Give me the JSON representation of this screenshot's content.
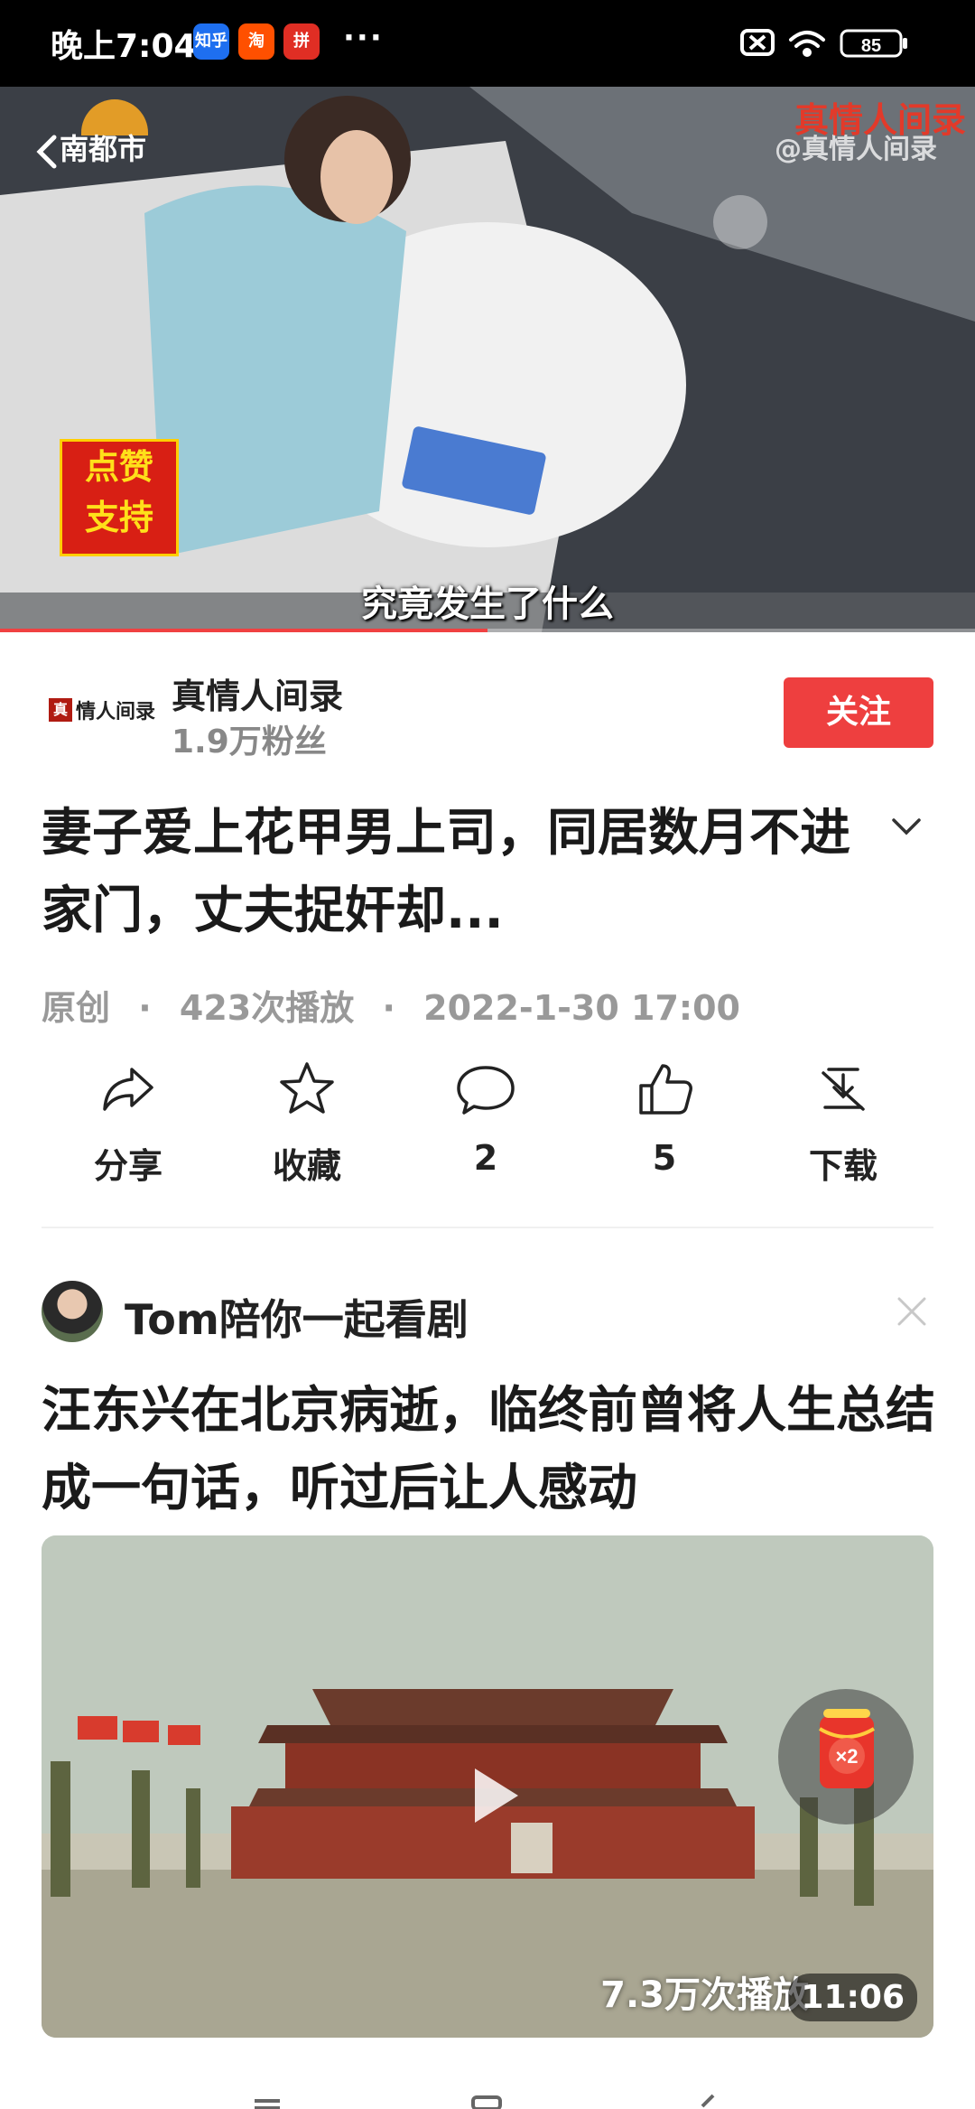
{
  "status_bar": {
    "time": "晚上7:04",
    "apps": [
      {
        "name": "zhihu-icon",
        "label": "知乎",
        "color": "#1e6ff0"
      },
      {
        "name": "taobao-icon",
        "label": "淘",
        "color": "#ff5000"
      },
      {
        "name": "pinduoduo-icon",
        "label": "拼",
        "color": "#e02e24"
      }
    ],
    "more": "···",
    "battery": "85"
  },
  "player": {
    "channel": "南都市",
    "watermark": "@真情人间录",
    "brand": "真情人间录",
    "like_badge_line1": "点赞",
    "like_badge_line2": "支持",
    "subtitle": "究竟发生了什么",
    "progress": 0.5
  },
  "author": {
    "logo_text": "情人间录",
    "logo_seal": "真",
    "name": "真情人间录",
    "fans": "1.9万粉丝",
    "follow_label": "关注"
  },
  "video": {
    "title": "妻子爱上花甲男上司，同居数月不进家门，丈夫捉奸却...",
    "meta_original": "原创",
    "meta_plays": "423次播放",
    "meta_date": "2022-1-30 17:00",
    "sep": "·"
  },
  "actions": {
    "share": "分享",
    "favorite": "收藏",
    "comments": "2",
    "likes": "5",
    "download": "下载"
  },
  "recommendation": {
    "author": "Tom陪你一起看剧",
    "title": "汪东兴在北京病逝，临终前曾将人生总结成一句话，听过后让人感动",
    "plays": "7.3万次播放",
    "duration": "11:06",
    "reward_badge": "×2"
  },
  "colors": {
    "accent": "#ee3f3f",
    "muted": "#999999"
  }
}
